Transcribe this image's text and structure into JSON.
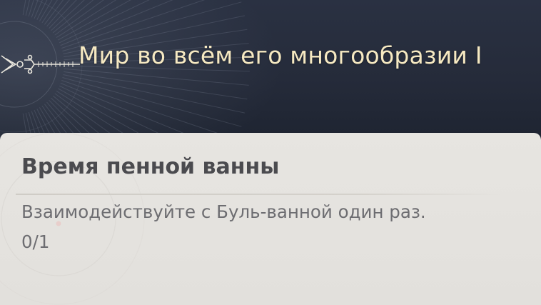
{
  "achievement": {
    "title": "Мир во всём его многообразии I",
    "emblem_icon": "achievement-emblem-icon"
  },
  "task": {
    "name": "Время пенной ванны",
    "description": "Взаимодействуйте с Буль-ванной один раз.",
    "progress": "0/1",
    "progress_current": 0,
    "progress_total": 1
  },
  "colors": {
    "banner_background": "#262c3b",
    "title_text": "#f6e9c2",
    "card_background": "#e5e3df",
    "task_name_text": "#4b4b4f",
    "description_text": "#6d6d71"
  }
}
